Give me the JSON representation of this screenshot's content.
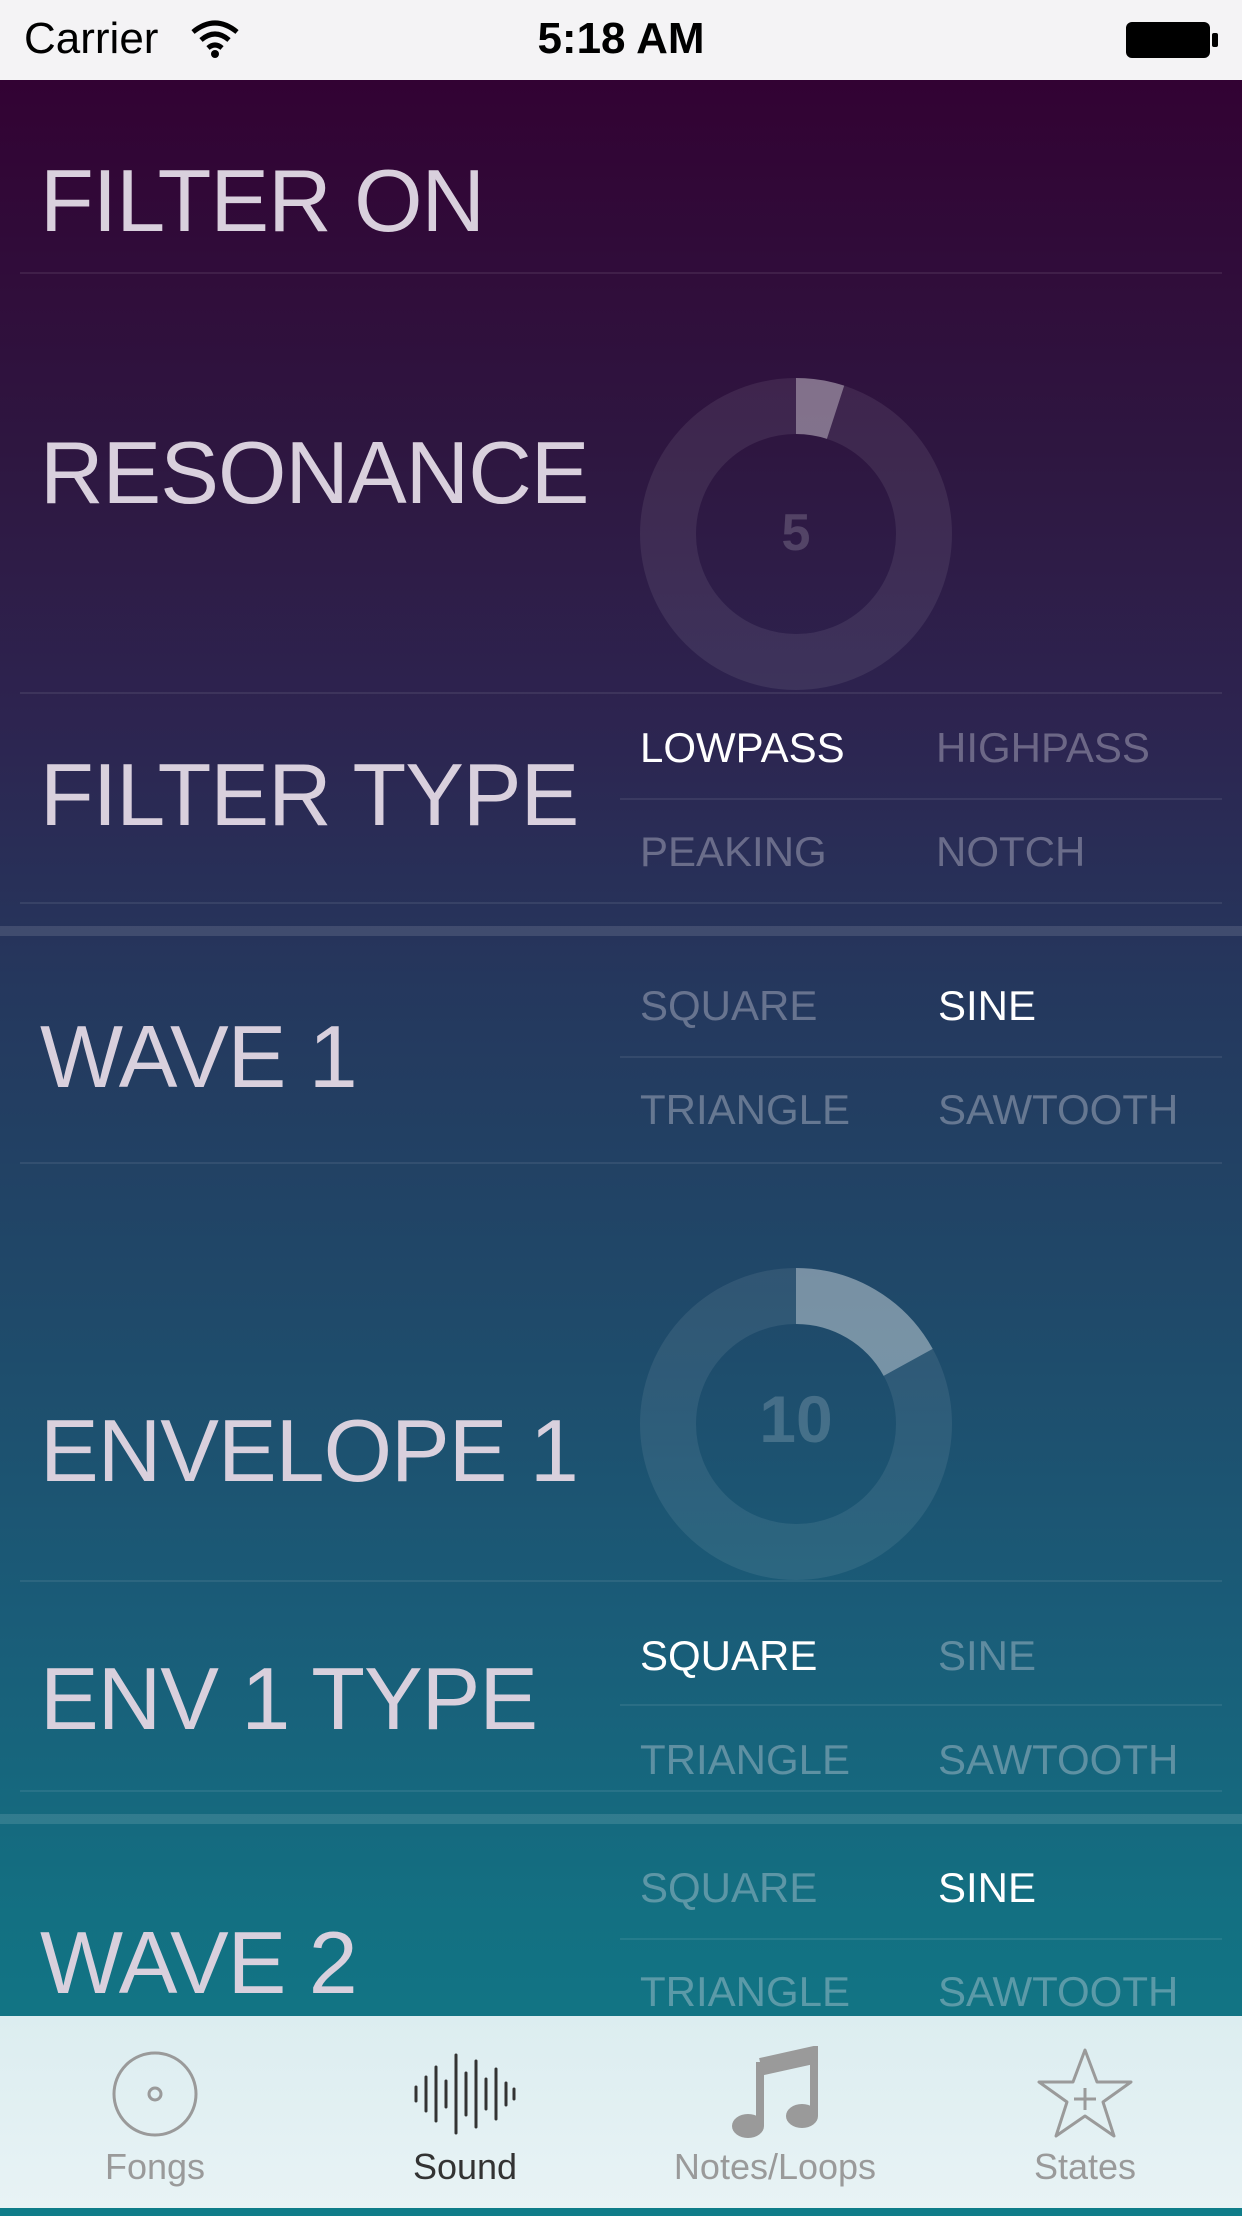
{
  "status_bar": {
    "carrier": "Carrier",
    "time": "5:18 AM"
  },
  "filter_on": {
    "label": "FILTER ON"
  },
  "resonance": {
    "label": "RESONANCE",
    "value": "5",
    "fraction": 0.05
  },
  "filter_type": {
    "label": "FILTER TYPE",
    "options": [
      "LOWPASS",
      "HIGHPASS",
      "PEAKING",
      "NOTCH"
    ],
    "selected": "LOWPASS"
  },
  "wave1": {
    "label": "WAVE 1",
    "options": [
      "SQUARE",
      "SINE",
      "TRIANGLE",
      "SAWTOOTH"
    ],
    "selected": "SINE"
  },
  "envelope1": {
    "label": "ENVELOPE 1",
    "value": "10",
    "fraction": 0.17
  },
  "env1_type": {
    "label": "ENV 1 TYPE",
    "options": [
      "SQUARE",
      "SINE",
      "TRIANGLE",
      "SAWTOOTH"
    ],
    "selected": "SQUARE"
  },
  "wave2": {
    "label": "WAVE 2",
    "options": [
      "SQUARE",
      "SINE",
      "TRIANGLE",
      "SAWTOOTH"
    ],
    "selected": "SINE"
  },
  "tabs": [
    {
      "label": "Fongs",
      "icon": "disc-icon",
      "active": false
    },
    {
      "label": "Sound",
      "icon": "waveform-icon",
      "active": true
    },
    {
      "label": "Notes/Loops",
      "icon": "music-note-icon",
      "active": false
    },
    {
      "label": "States",
      "icon": "star-plus-icon",
      "active": false
    }
  ]
}
